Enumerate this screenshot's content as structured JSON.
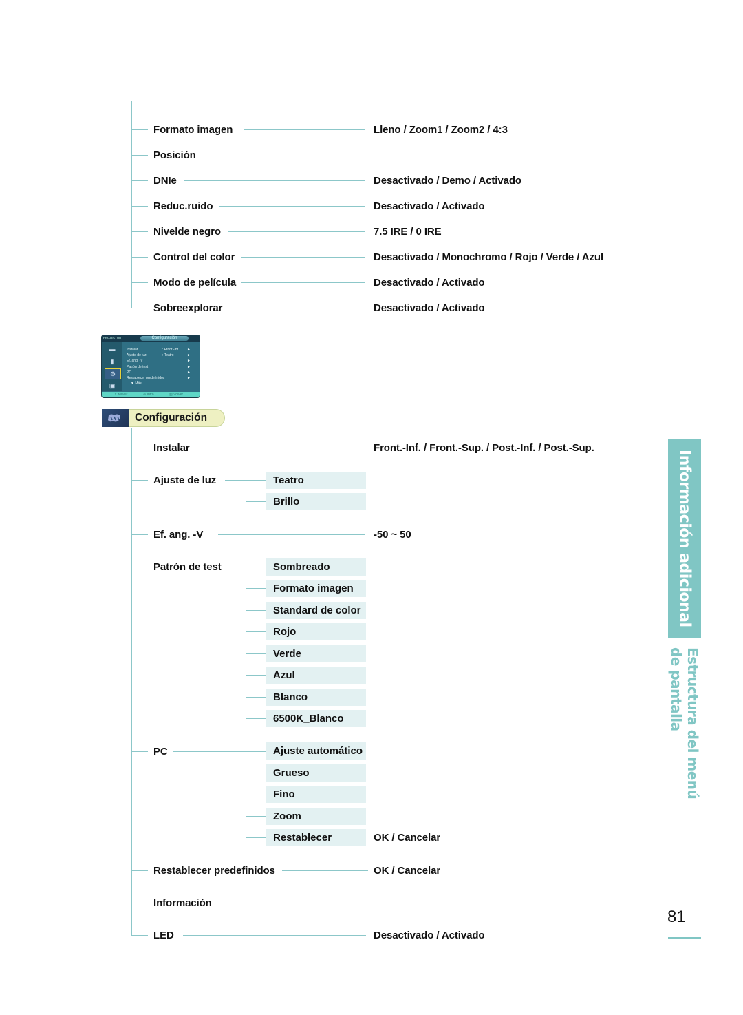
{
  "top_section": {
    "items": [
      {
        "label": "Formato imagen",
        "value": "Lleno /  Zoom1 / Zoom2 / 4:3"
      },
      {
        "label": "Posición",
        "value": null
      },
      {
        "label": "DNIe",
        "value": "Desactivado / Demo / Activado"
      },
      {
        "label": "Reduc.ruido",
        "value": "Desactivado / Activado"
      },
      {
        "label": "Nivelde negro",
        "value": "7.5 IRE / 0 IRE"
      },
      {
        "label": "Control del color",
        "value": "Desactivado / Monochromo / Rojo / Verde / Azul"
      },
      {
        "label": "Modo de película",
        "value": "Desactivado / Activado"
      },
      {
        "label": "Sobreexplorar",
        "value": "Desactivado / Activado"
      }
    ]
  },
  "osd_thumbnail": {
    "brand": "PROJECTOR",
    "title": "Configuración",
    "rows": [
      {
        "label": "Instalar",
        "value": ": Front.-Inf.",
        "arrow": "►"
      },
      {
        "label": "Ajuste de luz",
        "value": ": Teatro",
        "arrow": "►"
      },
      {
        "label": "Ef. ang. -V",
        "value": "",
        "arrow": "►"
      },
      {
        "label": "Patrón de test",
        "value": "",
        "arrow": "►"
      },
      {
        "label": "PC",
        "value": "",
        "arrow": "►"
      },
      {
        "label": "Restablecer predefinidos",
        "value": "",
        "arrow": "►"
      },
      {
        "label": "▼ Más",
        "value": "",
        "arrow": ""
      }
    ],
    "footer": {
      "move": "⇕ Mover",
      "enter": "⏎ Intro",
      "back": "▥ Volver"
    }
  },
  "section": {
    "title": "Configuración"
  },
  "config": {
    "instalar": {
      "label": "Instalar",
      "value": "Front.-Inf. / Front.-Sup. / Post.-Inf. / Post.-Sup."
    },
    "ajuste_luz": {
      "label": "Ajuste de luz",
      "options": [
        "Teatro",
        "Brillo"
      ]
    },
    "ef_ang": {
      "label": "Ef. ang. -V",
      "value": "-50 ~ 50"
    },
    "patron": {
      "label": "Patrón de test",
      "options": [
        "Sombreado",
        "Formato imagen",
        "Standard de color",
        "Rojo",
        "Verde",
        "Azul",
        "Blanco",
        "6500K_Blanco"
      ]
    },
    "pc": {
      "label": "PC",
      "options": [
        "Ajuste automático",
        "Grueso",
        "Fino",
        "Zoom",
        "Restablecer"
      ],
      "restablecer_value": "OK / Cancelar"
    },
    "restablecer_pred": {
      "label": "Restablecer predefinidos",
      "value": "OK / Cancelar"
    },
    "informacion": {
      "label": "Información"
    },
    "led": {
      "label": "LED",
      "value": "Desactivado / Activado"
    }
  },
  "side_tab": {
    "title": "Información adicional",
    "subtitle": "Estructura del menú de pantalla"
  },
  "page_number": "81",
  "colors": {
    "accent": "#80c6c4",
    "line": "#8cc7c9",
    "box": "#e3f1f2",
    "section_pill": "#eef0c2"
  }
}
